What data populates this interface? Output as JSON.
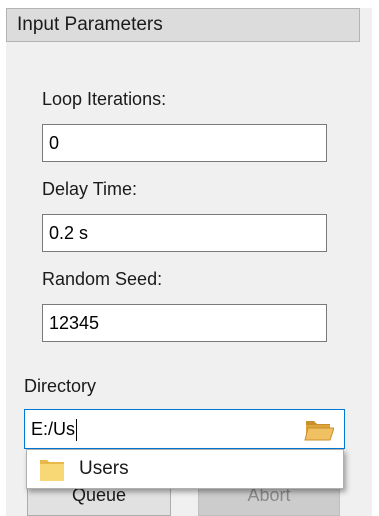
{
  "panel": {
    "title": "Input Parameters"
  },
  "params": {
    "loop_iterations": {
      "label": "Loop Iterations:",
      "value": "0"
    },
    "delay_time": {
      "label": "Delay Time:",
      "value": "0.2 s"
    },
    "random_seed": {
      "label": "Random Seed:",
      "value": "12345"
    }
  },
  "directory": {
    "label": "Directory",
    "value": "E:/Us",
    "browse_icon": "folder-open-icon"
  },
  "autocomplete": {
    "items": [
      {
        "label": "Users",
        "icon": "folder-icon"
      }
    ]
  },
  "buttons": {
    "queue_label": "Queue",
    "abort_label": "Abort"
  },
  "colors": {
    "panel_bg": "#f0f0f0",
    "header_bg": "#dcdcdc",
    "focus_border": "#0078d7",
    "folder_yellow": "#f8d775"
  }
}
